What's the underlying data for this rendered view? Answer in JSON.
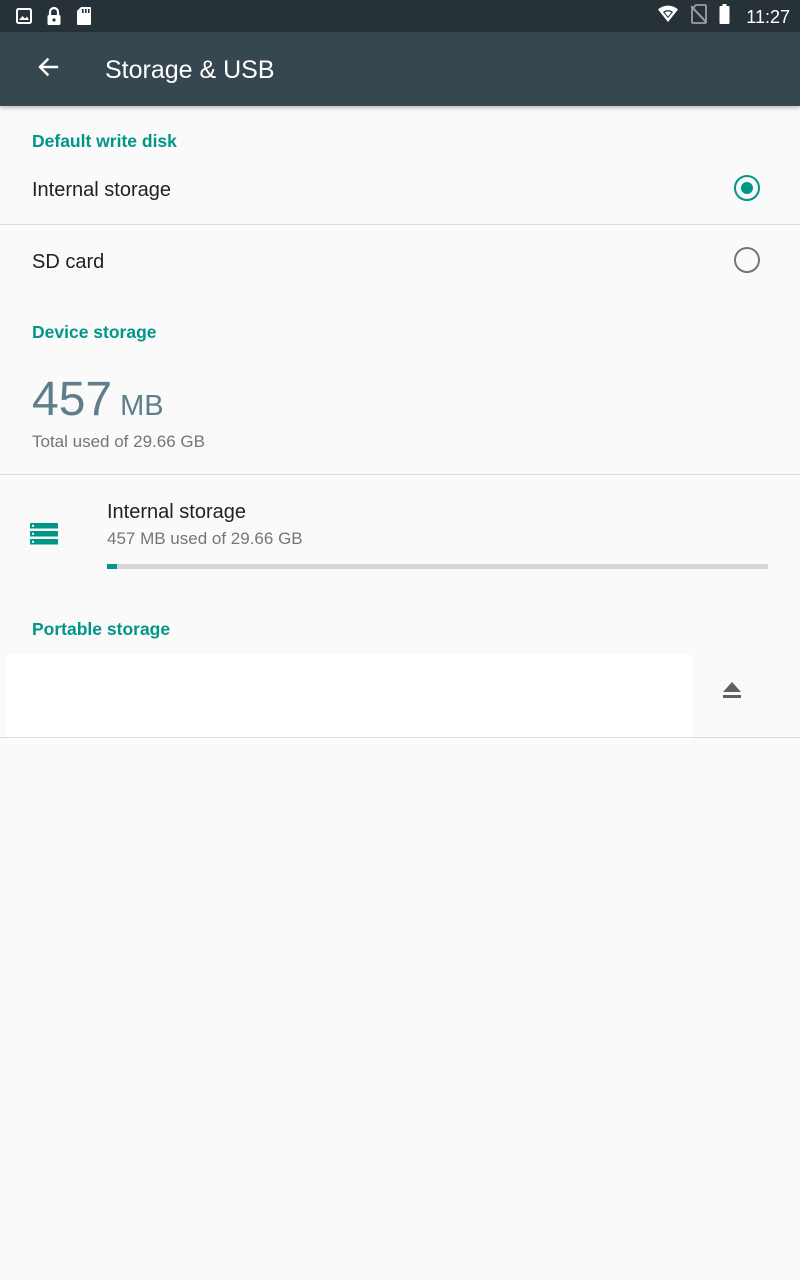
{
  "status_bar": {
    "time": "11:27",
    "left_icons": [
      "image-icon",
      "lock-icon",
      "sd-card-icon"
    ],
    "right_icons": [
      "wifi-icon",
      "no-sim-icon",
      "battery-icon"
    ]
  },
  "app_bar": {
    "back_icon": "arrow-back-icon",
    "title": "Storage & USB"
  },
  "default_write_disk": {
    "header": "Default write disk",
    "options": [
      {
        "label": "Internal storage",
        "selected": true
      },
      {
        "label": "SD card",
        "selected": false
      }
    ]
  },
  "device_storage": {
    "header": "Device storage",
    "used_value": "457",
    "used_unit": "MB",
    "total_line": "Total used of 29.66 GB",
    "volume": {
      "icon": "storage-icon",
      "title": "Internal storage",
      "subtitle": "457 MB used of 29.66 GB",
      "progress_fraction": 0.015
    }
  },
  "portable_storage": {
    "header": "Portable storage",
    "eject_icon": "eject-icon"
  },
  "colors": {
    "accent": "#009688",
    "app_bar": "#37474f",
    "status_bar": "#263238",
    "background": "#fafafa"
  }
}
